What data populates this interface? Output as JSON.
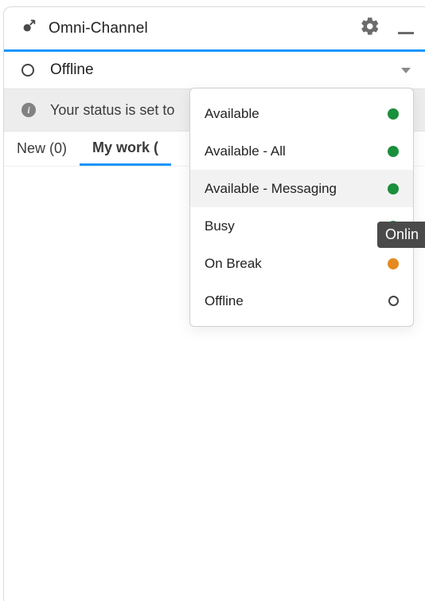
{
  "header": {
    "title": "Omni-Channel"
  },
  "status": {
    "current": "Offline"
  },
  "info": {
    "message": "Your status is set to"
  },
  "tabs": {
    "new": "New (0)",
    "mywork": "My work ("
  },
  "dropdown": {
    "items": [
      {
        "label": "Available",
        "color": "green"
      },
      {
        "label": "Available - All",
        "color": "green"
      },
      {
        "label": "Available - Messaging",
        "color": "green",
        "hover": true
      },
      {
        "label": "Busy",
        "color": "hidden"
      },
      {
        "label": "On Break",
        "color": "orange"
      },
      {
        "label": "Offline",
        "color": "hollow"
      }
    ]
  },
  "tooltip": {
    "text": "Onlin"
  }
}
